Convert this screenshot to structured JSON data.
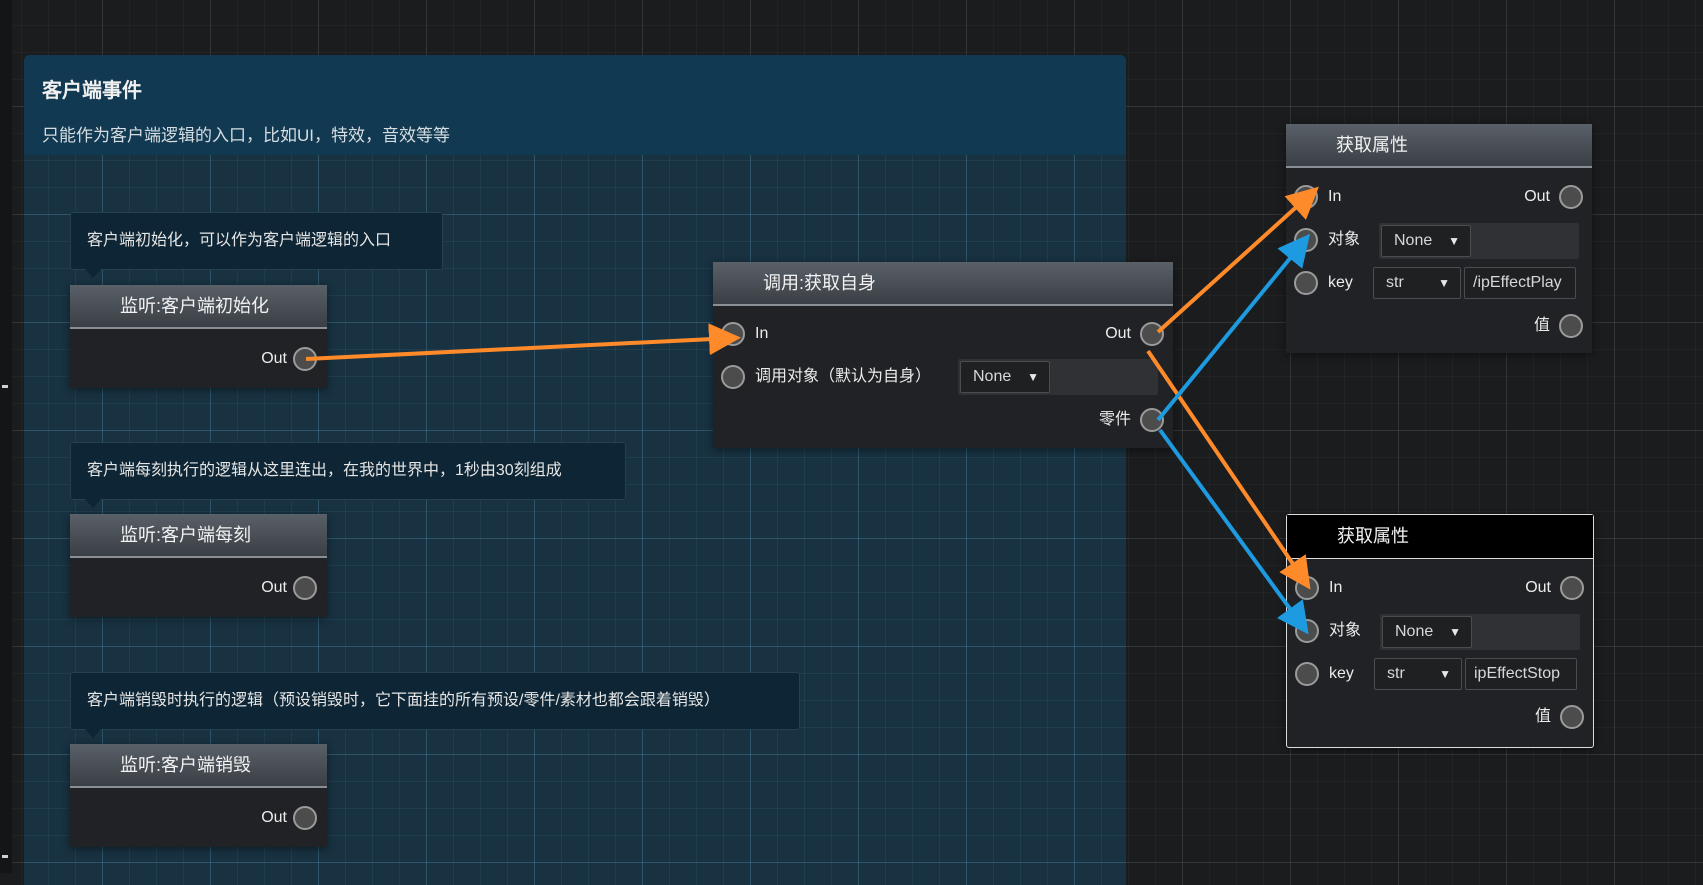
{
  "group": {
    "title": "客户端事件",
    "description": "只能作为客户端逻辑的入口，比如UI，特效，音效等等"
  },
  "comments": [
    {
      "text": "客户端初始化，可以作为客户端逻辑的入口"
    },
    {
      "text": "客户端每刻执行的逻辑从这里连出，在我的世界中，1秒由30刻组成"
    },
    {
      "text": "客户端销毁时执行的逻辑（预设销毁时，它下面挂的所有预设/零件/素材也都会跟着销毁）"
    }
  ],
  "listen_nodes": [
    {
      "title": "监听:客户端初始化",
      "out_label": "Out"
    },
    {
      "title": "监听:客户端每刻",
      "out_label": "Out"
    },
    {
      "title": "监听:客户端销毁",
      "out_label": "Out"
    }
  ],
  "call_node": {
    "title": "调用:获取自身",
    "in_label": "In",
    "out_label": "Out",
    "target_label": "调用对象（默认为自身）",
    "target_value": "None",
    "part_label": "零件"
  },
  "get_nodes": [
    {
      "title": "获取属性",
      "in_label": "In",
      "out_label": "Out",
      "object_label": "对象",
      "object_value": "None",
      "key_label": "key",
      "key_type": "str",
      "key_value": "/ipEffectPlay",
      "value_label": "值"
    },
    {
      "title": "获取属性",
      "in_label": "In",
      "out_label": "Out",
      "object_label": "对象",
      "object_value": "None",
      "key_label": "key",
      "key_type": "str",
      "key_value": "ipEffectStop",
      "value_label": "值"
    }
  ],
  "colors": {
    "exec_wire": "#ff8a2a",
    "data_wire": "#1e9be0",
    "group_header": "#113a52"
  }
}
